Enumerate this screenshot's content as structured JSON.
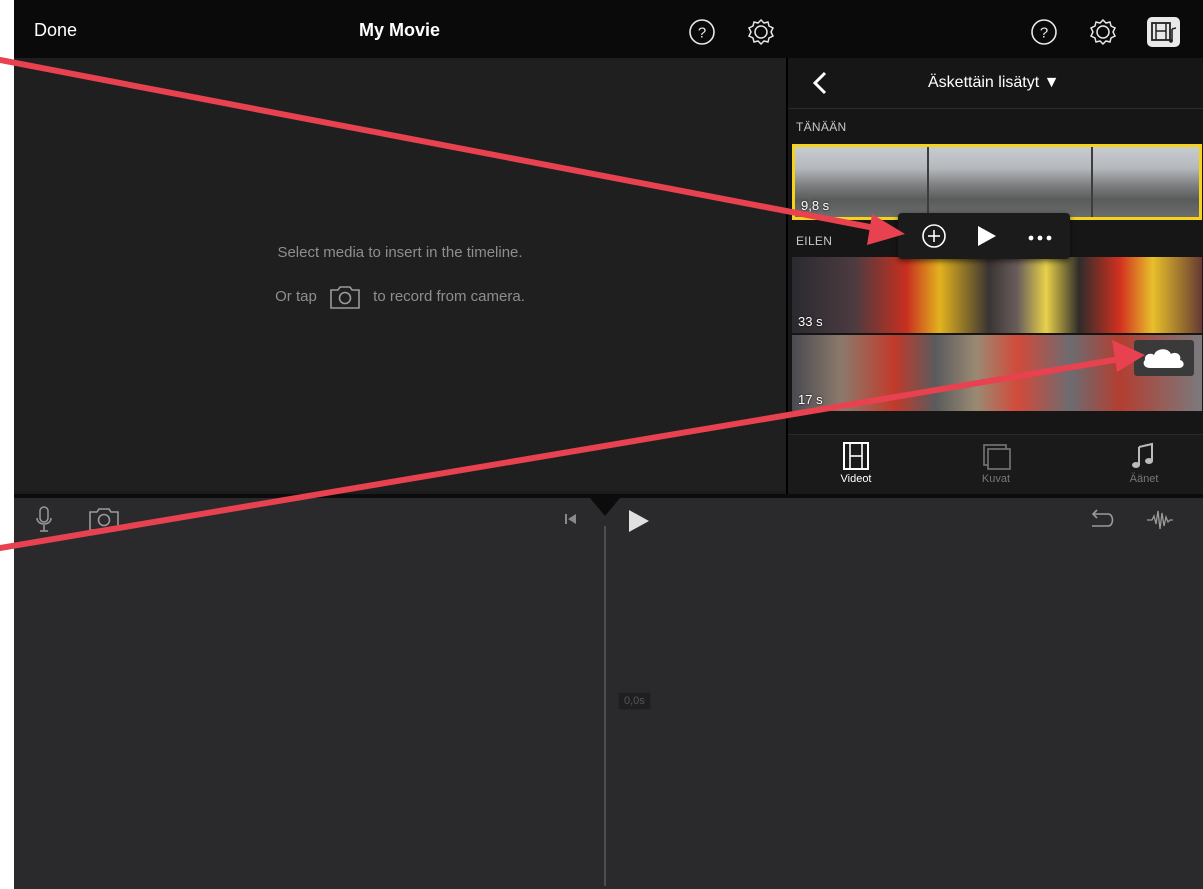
{
  "topbar": {
    "done_label": "Done",
    "title": "My Movie"
  },
  "viewer": {
    "hint_line1": "Select media to insert in the timeline.",
    "hint_line2_prefix": "Or tap",
    "hint_line2_suffix": "to record from camera."
  },
  "panel": {
    "album_title": "Äskettäin lisätyt ▼",
    "sections": {
      "today": "TÄNÄÄN",
      "yesterday": "EILEN"
    },
    "clips": [
      {
        "duration": "9,8 s"
      },
      {
        "duration": "33 s"
      },
      {
        "duration": "17 s"
      }
    ],
    "tabs": [
      {
        "label": "Videot",
        "icon": "film-icon",
        "active": true
      },
      {
        "label": "Kuvat",
        "icon": "photos-icon",
        "active": false
      },
      {
        "label": "Äänet",
        "icon": "music-note-icon",
        "active": false
      }
    ]
  },
  "timeline": {
    "timecode": "0,0s"
  },
  "colors": {
    "highlight": "#f5d21b",
    "annotation_arrow": "#e84150"
  }
}
